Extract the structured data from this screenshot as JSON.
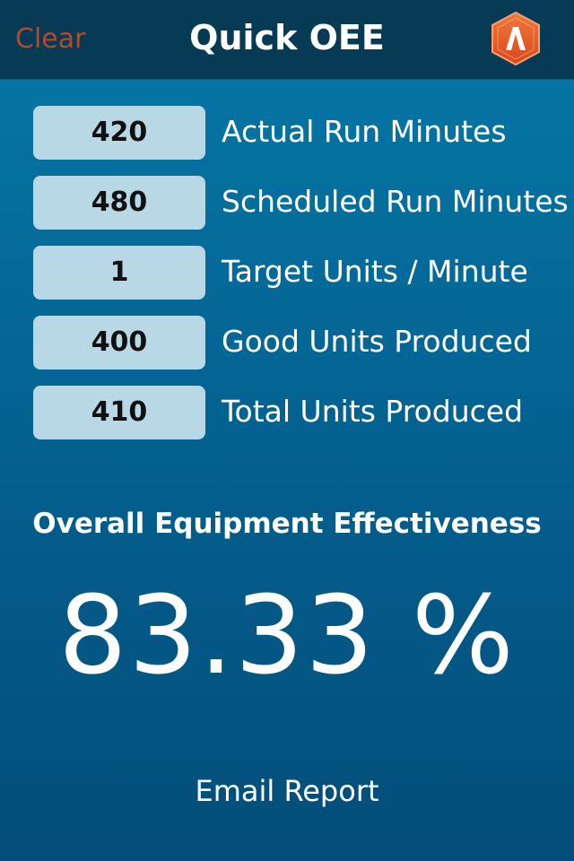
{
  "navbar": {
    "clear_label": "Clear",
    "title": "Quick OEE",
    "logo_icon": "app-logo-icon",
    "logo_letter": "A"
  },
  "fields": [
    {
      "value": "420",
      "label": "Actual Run Minutes"
    },
    {
      "value": "480",
      "label": "Scheduled Run Minutes"
    },
    {
      "value": "1",
      "label": "Target Units / Minute"
    },
    {
      "value": "400",
      "label": "Good Units Produced"
    },
    {
      "value": "410",
      "label": "Total Units Produced"
    }
  ],
  "result": {
    "heading": "Overall Equipment Effectiveness",
    "value": "83.33 %"
  },
  "footer": {
    "email_label": "Email Report"
  },
  "colors": {
    "clear_text": "#b24a2b",
    "navbar_bg": "#063a55",
    "input_bg": "#b9d8e6",
    "logo_orange": "#e85a26"
  }
}
